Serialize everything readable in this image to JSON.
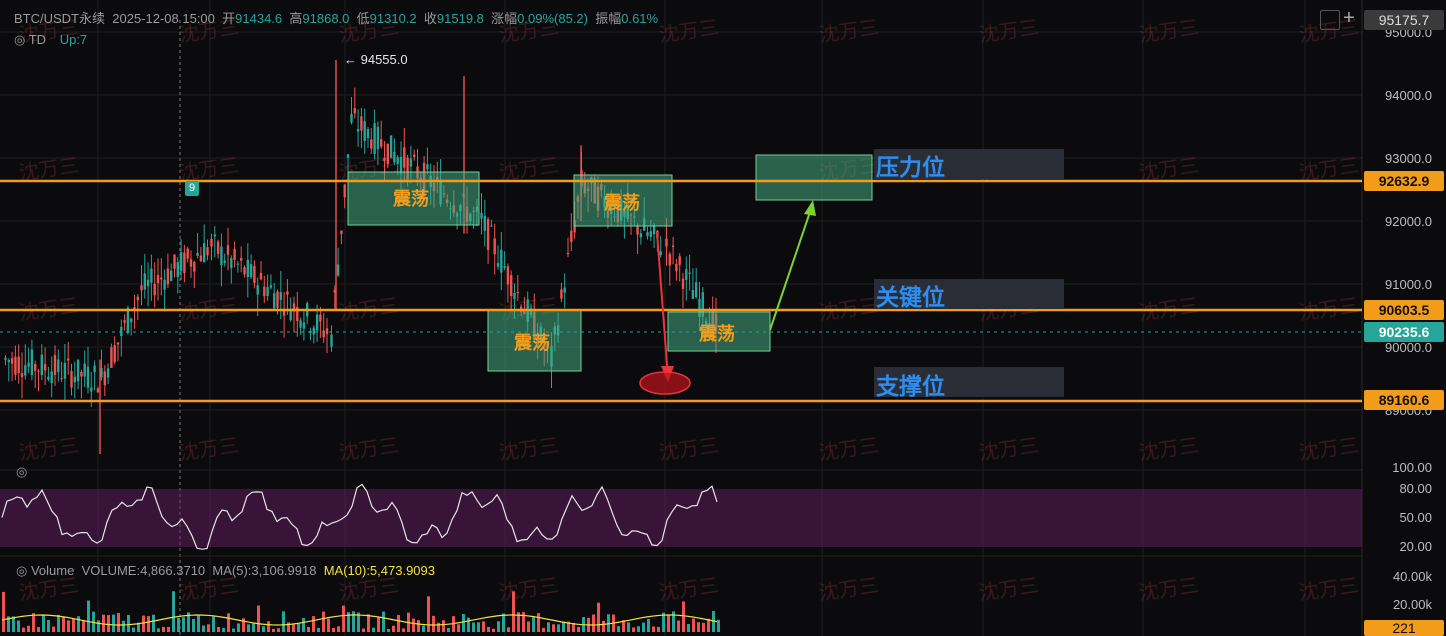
{
  "header": {
    "symbol": "BTC/USDT永续",
    "datetime": "2025-12-08 15:00",
    "open_label": "开",
    "open": "91434.6",
    "high_label": "高",
    "high": "91868.0",
    "low_label": "低",
    "low": "91310.2",
    "close_label": "收",
    "close": "91519.8",
    "change_label": "涨幅",
    "change": "0.09%(85.2)",
    "amp_label": "振幅",
    "amp": "0.61%"
  },
  "indicator": {
    "name": "TD",
    "up_text": "Up:7"
  },
  "annotations": {
    "high_marker": "← 94555.0",
    "td_count": "9"
  },
  "zones": [
    "震荡",
    "震荡",
    "震荡",
    "震荡"
  ],
  "levels": {
    "resistance": "压力位",
    "key": "关键位",
    "support": "支撑位"
  },
  "price_axis": [
    "95175.7",
    "95000.0",
    "94000.0",
    "93000.0",
    "92632.9",
    "92000.0",
    "91000.0",
    "90603.5",
    "90235.6",
    "90000.0",
    "89160.6",
    "89000.0"
  ],
  "tags": {
    "top": "95175.7",
    "resistance": "92632.9",
    "key": "90603.5",
    "current": "90235.6",
    "support": "89160.6",
    "volume": "221"
  },
  "osc_axis": [
    "100.00",
    "80.00",
    "50.00",
    "20.00"
  ],
  "volume": {
    "label": "Volume",
    "value": "VOLUME:4,866.3710",
    "ma5": "MA(5):3,106.9918",
    "ma10": "MA(10):5,473.9093",
    "axis": [
      "40.00k",
      "20.00k"
    ]
  },
  "watermark": "沈万三",
  "colors": {
    "up": "#26a69a",
    "down": "#ef5350",
    "level": "#f39c1a",
    "label_blue": "#2e8ef0",
    "zone_fill": "#3a9a7a"
  }
}
